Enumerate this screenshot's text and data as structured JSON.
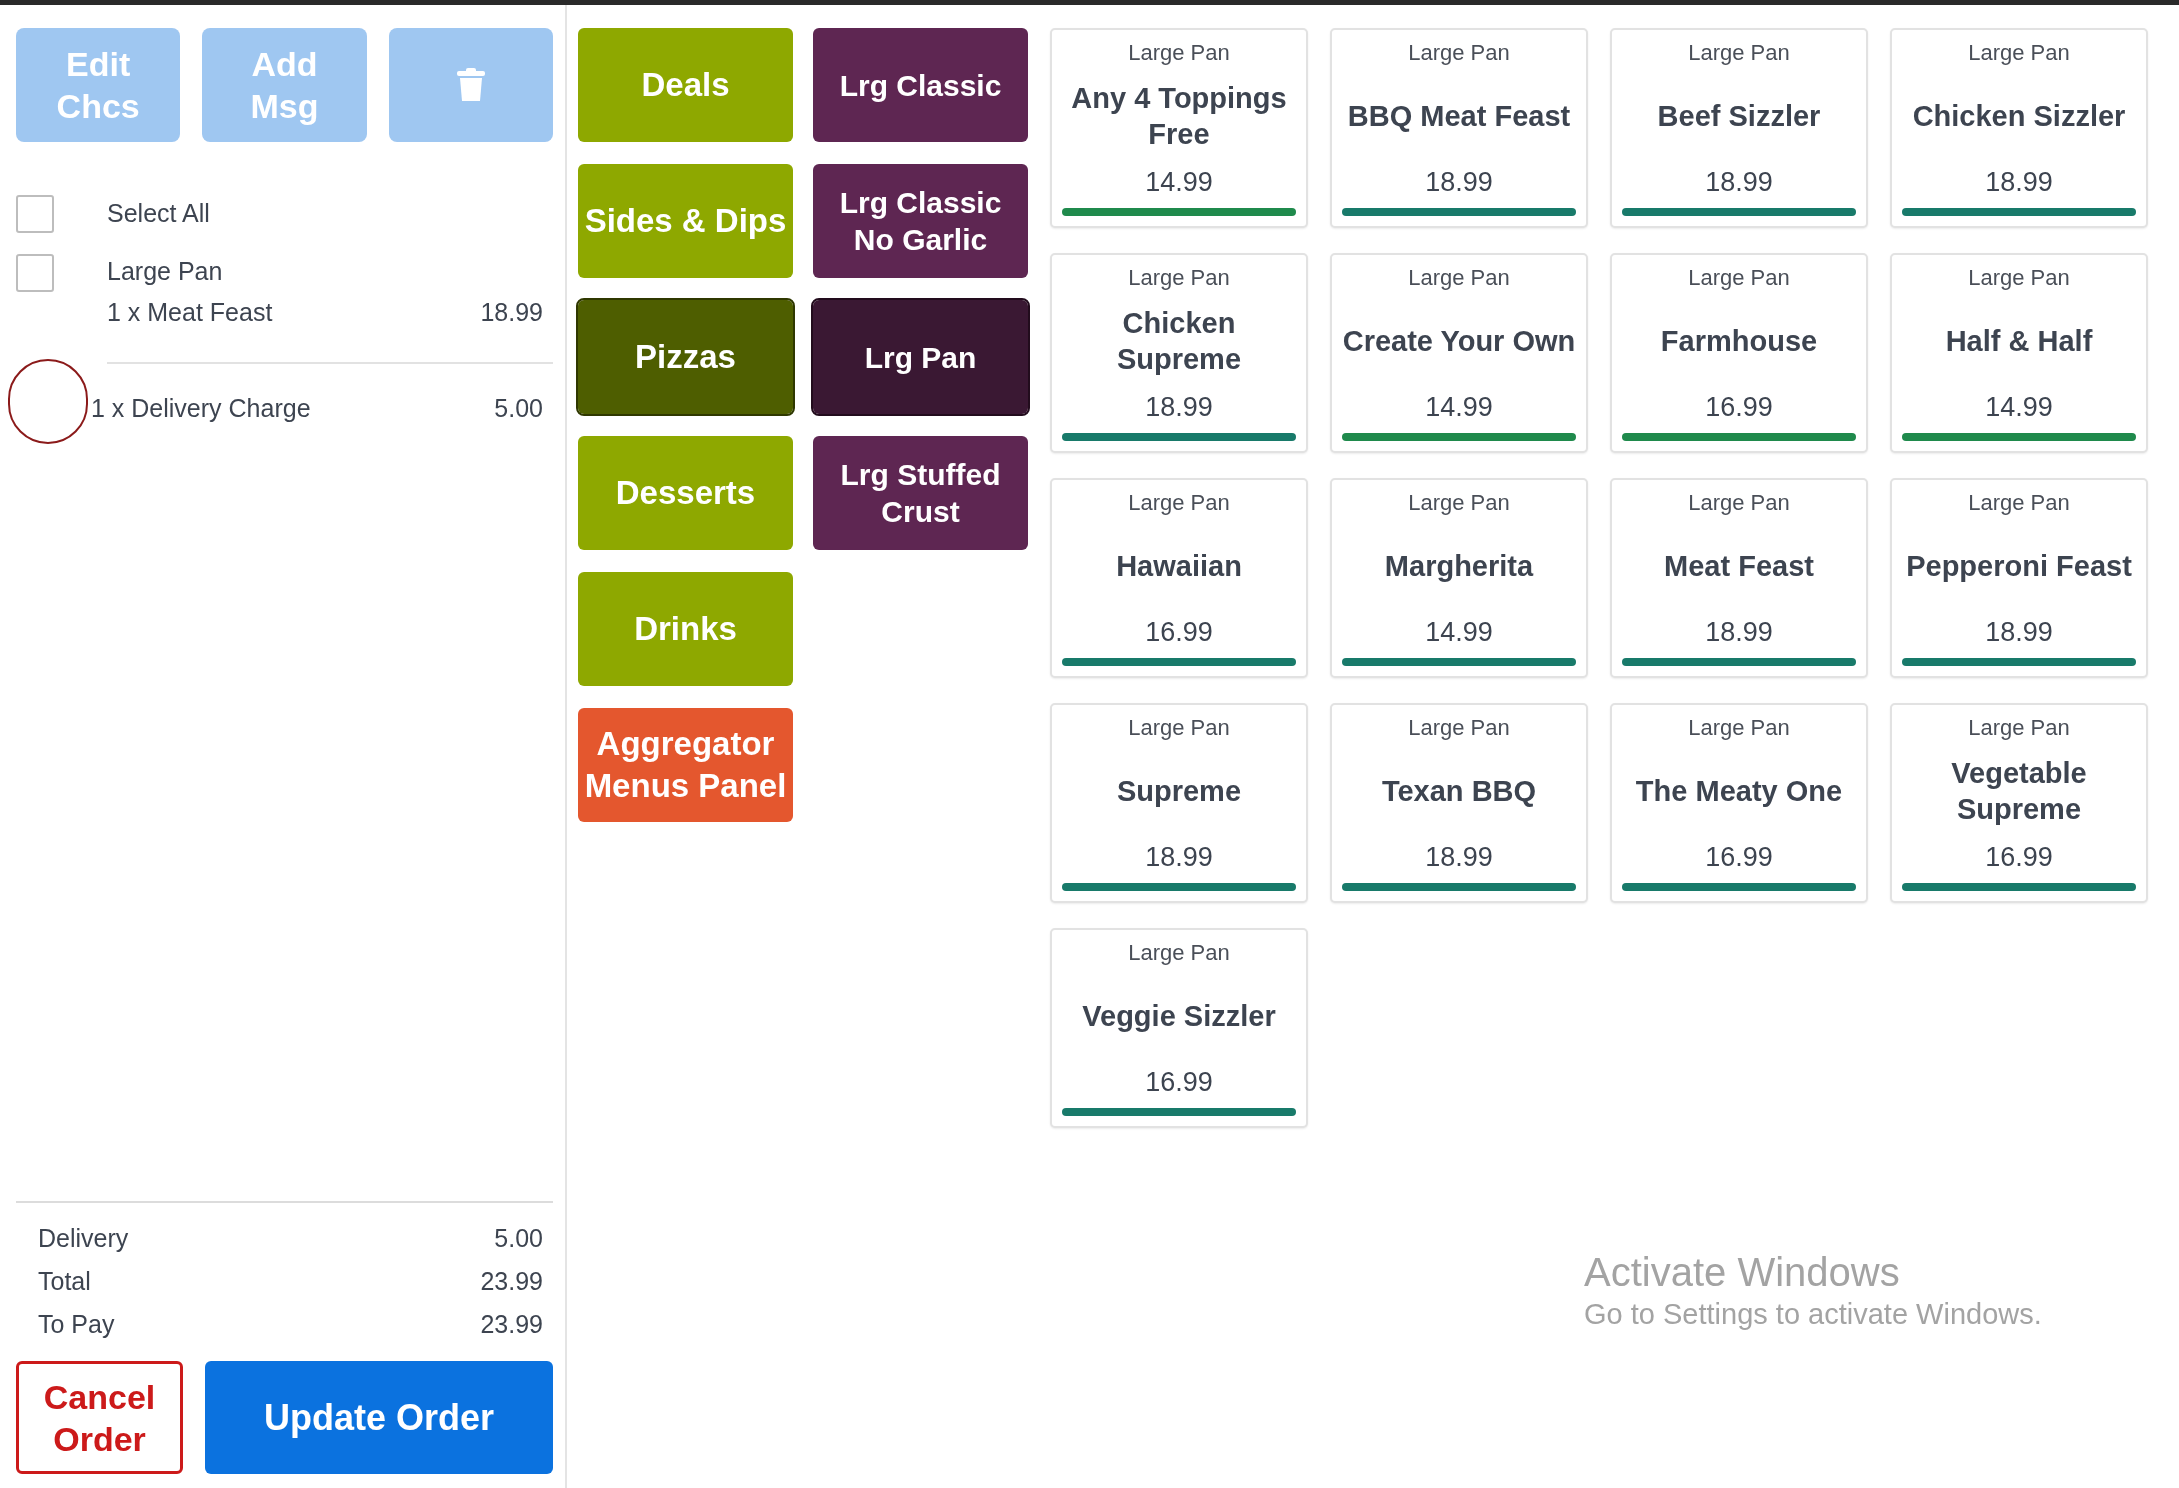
{
  "order_panel": {
    "actions": [
      {
        "kind": "text",
        "label": "Edit Chcs",
        "disabled": true
      },
      {
        "kind": "text",
        "label": "Add Msg",
        "disabled": true
      },
      {
        "kind": "trash",
        "disabled": true
      }
    ],
    "select_all": {
      "label": "Select All",
      "checked": false
    },
    "lines": [
      {
        "kind": "item",
        "checked": false,
        "title": "Large Pan",
        "description": "1 x Meat Feast",
        "price": "18.99"
      },
      {
        "kind": "charge",
        "description": "1 x Delivery Charge",
        "price": "5.00"
      }
    ],
    "totals": [
      {
        "label": "Delivery",
        "value": "5.00"
      },
      {
        "label": "Total",
        "value": "23.99"
      },
      {
        "label": "To Pay",
        "value": "23.99"
      }
    ],
    "cancel_button": "Cancel Order",
    "update_button": "Update Order"
  },
  "categories": [
    {
      "label": "Deals",
      "kind": "standard",
      "selected": false
    },
    {
      "label": "Sides & Dips",
      "kind": "standard",
      "selected": false
    },
    {
      "label": "Pizzas",
      "kind": "standard",
      "selected": true
    },
    {
      "label": "Desserts",
      "kind": "standard",
      "selected": false
    },
    {
      "label": "Drinks",
      "kind": "standard",
      "selected": false
    },
    {
      "label": "Aggregator Menus Panel",
      "kind": "aggregator",
      "selected": false
    }
  ],
  "subcategories": [
    {
      "label": "Lrg Classic",
      "selected": false
    },
    {
      "label": "Lrg Classic No Garlic",
      "selected": false
    },
    {
      "label": "Lrg Pan",
      "selected": true
    },
    {
      "label": "Lrg Stuffed Crust",
      "selected": false
    }
  ],
  "products": [
    {
      "size": "Large Pan",
      "name": "Any 4 Toppings Free",
      "price": "14.99",
      "color": "#1f8a4c"
    },
    {
      "size": "Large Pan",
      "name": "BBQ Meat Feast",
      "price": "18.99",
      "color": "#187a6a"
    },
    {
      "size": "Large Pan",
      "name": "Beef Sizzler",
      "price": "18.99",
      "color": "#187a6a"
    },
    {
      "size": "Large Pan",
      "name": "Chicken Sizzler",
      "price": "18.99",
      "color": "#187a6a"
    },
    {
      "size": "Large Pan",
      "name": "Chicken Supreme",
      "price": "18.99",
      "color": "#187a6a"
    },
    {
      "size": "Large Pan",
      "name": "Create Your Own",
      "price": "14.99",
      "color": "#1f8a4c"
    },
    {
      "size": "Large Pan",
      "name": "Farmhouse",
      "price": "16.99",
      "color": "#1f8a4c"
    },
    {
      "size": "Large Pan",
      "name": "Half & Half",
      "price": "14.99",
      "color": "#1f8a4c"
    },
    {
      "size": "Large Pan",
      "name": "Hawaiian",
      "price": "16.99",
      "color": "#187a6a"
    },
    {
      "size": "Large Pan",
      "name": "Margherita",
      "price": "14.99",
      "color": "#187a6a"
    },
    {
      "size": "Large Pan",
      "name": "Meat Feast",
      "price": "18.99",
      "color": "#187a6a"
    },
    {
      "size": "Large Pan",
      "name": "Pepperoni Feast",
      "price": "18.99",
      "color": "#187a6a"
    },
    {
      "size": "Large Pan",
      "name": "Supreme",
      "price": "18.99",
      "color": "#187a6a"
    },
    {
      "size": "Large Pan",
      "name": "Texan BBQ",
      "price": "18.99",
      "color": "#187a6a"
    },
    {
      "size": "Large Pan",
      "name": "The Meaty One",
      "price": "16.99",
      "color": "#187a6a"
    },
    {
      "size": "Large Pan",
      "name": "Vegetable Supreme",
      "price": "16.99",
      "color": "#187a6a"
    },
    {
      "size": "Large Pan",
      "name": "Veggie Sizzler",
      "price": "16.99",
      "color": "#187a6a"
    }
  ],
  "system_notice": {
    "title": "Activate Windows",
    "subtitle": "Go to Settings to activate Windows."
  }
}
